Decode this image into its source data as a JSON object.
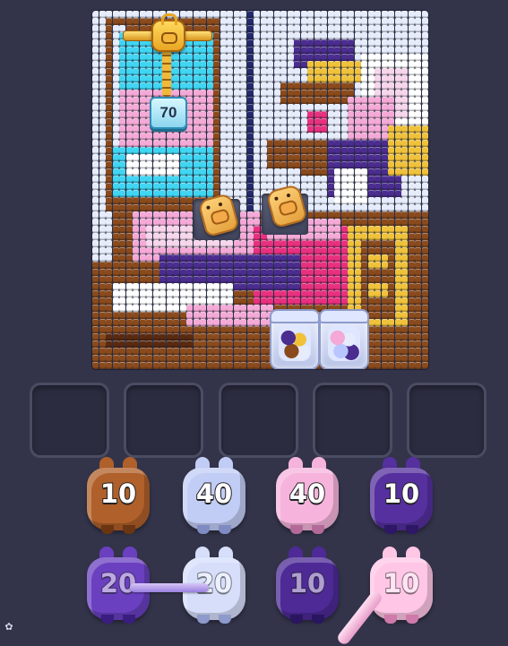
{
  "game": {
    "board": {
      "palette": {
        "B": "#8a4a1c",
        "L": "#e6ecfb",
        "N": "#242a6b",
        "P": "#f4a9d6",
        "H": "#e9307f",
        "C": "#3fd6f3",
        "Y": "#f0c23a",
        "V": "#4b2c8f",
        "W": "#ffffff",
        "K": "#f7d5ea",
        "D": "#5a2a10"
      },
      "lock": {
        "count": "70"
      },
      "jar_colors": [
        [
          "#4b2c8f",
          "#f0c23a",
          "#8a4a1c",
          "#e6ecfb"
        ],
        [
          "#f4a9d6",
          "#e6ecfb",
          "#b7c6ff",
          "#4b2c8f"
        ]
      ]
    },
    "slots": [
      "",
      "",
      "",
      "",
      ""
    ],
    "pig_rows": [
      [
        {
          "color": "#b0602a",
          "dark": "#6b3512",
          "value": "10"
        },
        {
          "color": "#c2cdf6",
          "dark": "#7f8bc2",
          "value": "40"
        },
        {
          "color": "#f6b4dc",
          "dark": "#b36a98",
          "value": "40"
        },
        {
          "color": "#55309e",
          "dark": "#2e1766",
          "value": "10"
        }
      ],
      [
        {
          "color": "#6a40c0",
          "dark": "#3a1d80",
          "value": "20"
        },
        {
          "color": "#d6defa",
          "dark": "#8d9acb",
          "value": "20"
        },
        {
          "color": "#4d2a96",
          "dark": "#2a1560",
          "value": "10"
        },
        {
          "color": "#ffc6e6",
          "dark": "#d07aab",
          "value": "10"
        }
      ]
    ]
  }
}
